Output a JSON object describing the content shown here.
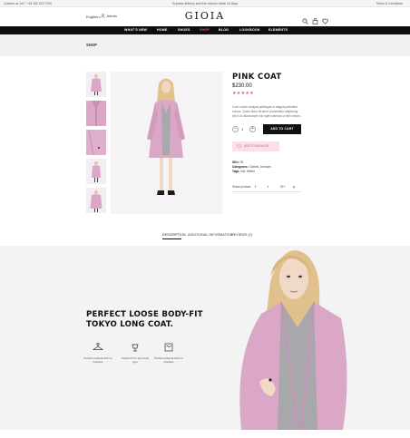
{
  "topbar": {
    "contact": "Contact us 24/7: +44 200 022 3700",
    "promo": "Express delivery and free returns within 24 days",
    "terms": "Terms & Conditions"
  },
  "header": {
    "language": "English",
    "account": "Admin",
    "logo": "GIOIA",
    "icons": [
      "search-icon",
      "bag-icon",
      "heart-icon"
    ]
  },
  "nav": {
    "items": [
      "WHAT'S NEW",
      "HOME",
      "SHOES",
      "SHOP",
      "BLOG",
      "LOOKBOOK",
      "ELEMENTS"
    ],
    "active_index": 3,
    "active_color": "#e15b76"
  },
  "breadcrumb": "SHOP",
  "product": {
    "title": "PINK COAT",
    "price": "$230.00",
    "stars": "★★★★★",
    "rating_out_of_5": 5,
    "description": "Cosh cursio volutpat pellesque et magna parturient cursus. Quam dolor sit amet consectetur adipiscing elit in ut ullamcorper nisi eget euismod ut nibh rutrum.",
    "quantity": "1",
    "qty_minus": "−",
    "qty_plus": "+",
    "add_to_cart": "ADD TO CART",
    "wishlist": "ADD TO WISHLIST",
    "sku_label": "SKU:",
    "sku": "09",
    "categories_label": "Categories:",
    "categories": "Clothes, Dresses",
    "tags_label": "Tags:",
    "tags": "Hat, Winter",
    "share_label": "Share product:",
    "share_icons": [
      "f",
      "t",
      "G+",
      "p"
    ]
  },
  "tabs": {
    "items": [
      "DESCRIPTION",
      "ADDITIONAL INFORMATION",
      "REVIEWS (2)"
    ],
    "active_index": 0
  },
  "hero": {
    "title_line1": "PERFECT LOOSE BODY-FIT",
    "title_line2": "TOKYO LONG COAT.",
    "features": [
      {
        "icon": "hanger-icon",
        "text": "Perfect material with no wrinkles"
      },
      {
        "icon": "iron-icon",
        "text": "Perfect fit for any body type"
      },
      {
        "icon": "wash-icon",
        "text": "Perfect material with no wrinkles"
      }
    ]
  },
  "colors": {
    "accent": "#e15b76",
    "coat": "#dba7c6",
    "nav_bg": "#0e0e0e",
    "wishlist_bg": "#fbe1e6"
  }
}
